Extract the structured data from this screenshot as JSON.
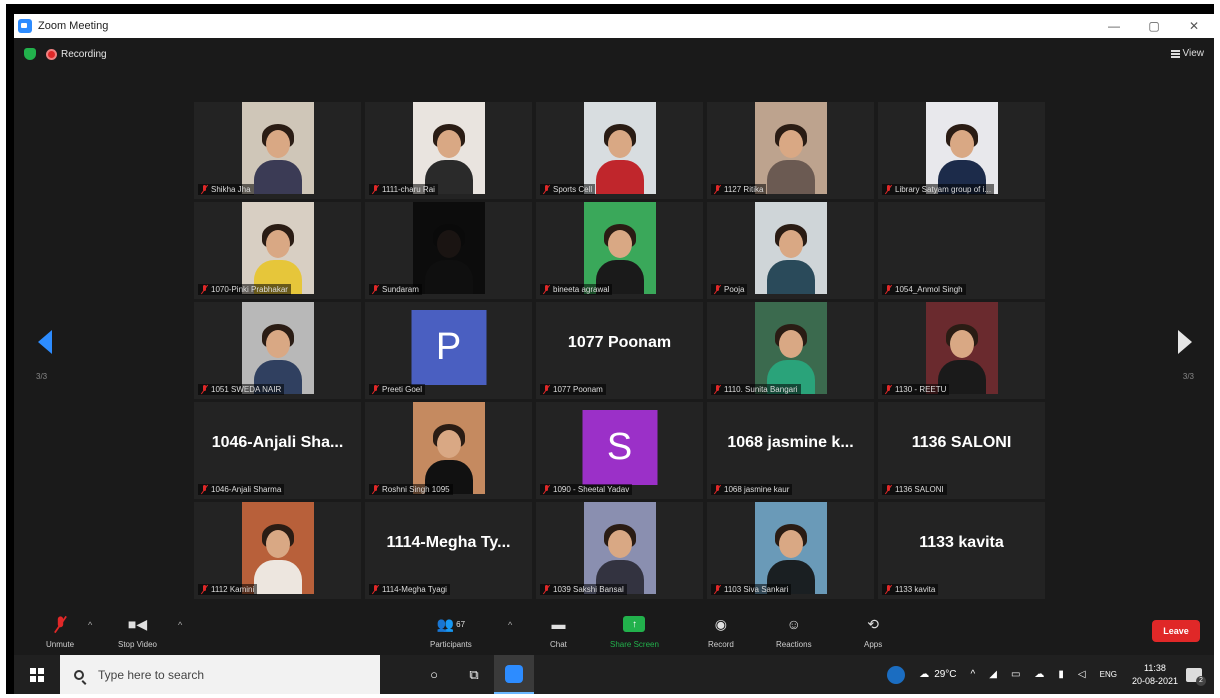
{
  "window": {
    "title": "Zoom Meeting"
  },
  "status": {
    "recording_label": "Recording",
    "view_label": "View"
  },
  "pagination": {
    "left": "3/3",
    "right": "3/3"
  },
  "tiles": [
    {
      "label": "Shikha Jha",
      "type": "photo",
      "bg": "#cfc6b8",
      "shirt": "#3b3b55"
    },
    {
      "label": "1111-charu Rai",
      "type": "photo",
      "bg": "#e9e4df",
      "shirt": "#2a2a2a"
    },
    {
      "label": "Sports Cell",
      "type": "photo",
      "bg": "#d8dde0",
      "shirt": "#c0262c"
    },
    {
      "label": "1127 Ritika",
      "type": "photo",
      "bg": "#bda38e",
      "shirt": "#6b5a52"
    },
    {
      "label": "Library Satyam group of i...",
      "type": "photo",
      "bg": "#e8e8ec",
      "shirt": "#1c2b4a"
    },
    {
      "label": "1070-Pinki Prabhakar",
      "type": "photo",
      "bg": "#d8cfc3",
      "shirt": "#e6c63a"
    },
    {
      "label": "Sundaram",
      "type": "photo",
      "bg": "#0c0c0c",
      "shirt": "#0f0f0f"
    },
    {
      "label": "bineeta agrawal",
      "type": "photo",
      "bg": "#3aa85a",
      "shirt": "#1a1a1a"
    },
    {
      "label": "Pooja",
      "type": "photo",
      "bg": "#cfd5d8",
      "shirt": "#2a4a5a"
    },
    {
      "label": "1054_Anmol Singh",
      "type": "blank"
    },
    {
      "label": "1051 SWEDA NAIR",
      "type": "photo",
      "bg": "#b8b8b8",
      "shirt": "#304060"
    },
    {
      "label": "Preeti Goel",
      "type": "avatar",
      "letter": "P",
      "color": "#4a5fc1"
    },
    {
      "label": "1077 Poonam",
      "type": "name",
      "big": "1077 Poonam"
    },
    {
      "label": "1110. Sunita Bangari",
      "type": "photo",
      "bg": "#3b6a4e",
      "shirt": "#2aa37a"
    },
    {
      "label": "1130 - REETU",
      "type": "photo",
      "bg": "#6a2a2e",
      "shirt": "#1a1a1a"
    },
    {
      "label": "1046-Anjali Sharma",
      "type": "name",
      "big": "1046-Anjali Sha..."
    },
    {
      "label": "Roshni Singh 1095",
      "type": "photo",
      "bg": "#c58a60",
      "shirt": "#111111"
    },
    {
      "label": "1090 - Sheetal Yadav",
      "type": "avatar",
      "letter": "S",
      "color": "#9b30c8"
    },
    {
      "label": "1068 jasmine kaur",
      "type": "name",
      "big": "1068 jasmine k..."
    },
    {
      "label": "1136 SALONI",
      "type": "name",
      "big": "1136 SALONI"
    },
    {
      "label": "1112 Kamini",
      "type": "photo",
      "bg": "#b8603a",
      "shirt": "#ede6df"
    },
    {
      "label": "1114-Megha Tyagi",
      "type": "name",
      "big": "1114-Megha Ty..."
    },
    {
      "label": "1039 Sakshi Bansal",
      "type": "photo",
      "bg": "#8a8fb0",
      "shirt": "#333340"
    },
    {
      "label": "1103 Siva Sankari",
      "type": "photo",
      "bg": "#6a9ab8",
      "shirt": "#1a1f22"
    },
    {
      "label": "1133 kavita",
      "type": "name",
      "big": "1133 kavita"
    }
  ],
  "toolbar": {
    "unmute": "Unmute",
    "stop_video": "Stop Video",
    "participants": "Participants",
    "participants_count": "67",
    "chat": "Chat",
    "share_screen": "Share Screen",
    "record": "Record",
    "reactions": "Reactions",
    "apps": "Apps",
    "leave": "Leave"
  },
  "taskbar": {
    "search_placeholder": "Type here to search",
    "temperature": "29°C",
    "language": "ENG",
    "time": "11:38",
    "date": "20-08-2021",
    "notification_count": "2"
  }
}
